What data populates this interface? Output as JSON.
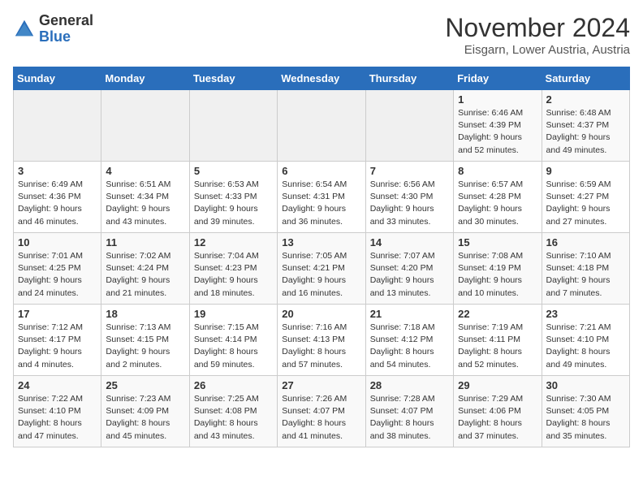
{
  "header": {
    "logo_general": "General",
    "logo_blue": "Blue",
    "month_title": "November 2024",
    "location": "Eisgarn, Lower Austria, Austria"
  },
  "weekdays": [
    "Sunday",
    "Monday",
    "Tuesday",
    "Wednesday",
    "Thursday",
    "Friday",
    "Saturday"
  ],
  "weeks": [
    [
      {
        "day": "",
        "info": ""
      },
      {
        "day": "",
        "info": ""
      },
      {
        "day": "",
        "info": ""
      },
      {
        "day": "",
        "info": ""
      },
      {
        "day": "",
        "info": ""
      },
      {
        "day": "1",
        "info": "Sunrise: 6:46 AM\nSunset: 4:39 PM\nDaylight: 9 hours\nand 52 minutes."
      },
      {
        "day": "2",
        "info": "Sunrise: 6:48 AM\nSunset: 4:37 PM\nDaylight: 9 hours\nand 49 minutes."
      }
    ],
    [
      {
        "day": "3",
        "info": "Sunrise: 6:49 AM\nSunset: 4:36 PM\nDaylight: 9 hours\nand 46 minutes."
      },
      {
        "day": "4",
        "info": "Sunrise: 6:51 AM\nSunset: 4:34 PM\nDaylight: 9 hours\nand 43 minutes."
      },
      {
        "day": "5",
        "info": "Sunrise: 6:53 AM\nSunset: 4:33 PM\nDaylight: 9 hours\nand 39 minutes."
      },
      {
        "day": "6",
        "info": "Sunrise: 6:54 AM\nSunset: 4:31 PM\nDaylight: 9 hours\nand 36 minutes."
      },
      {
        "day": "7",
        "info": "Sunrise: 6:56 AM\nSunset: 4:30 PM\nDaylight: 9 hours\nand 33 minutes."
      },
      {
        "day": "8",
        "info": "Sunrise: 6:57 AM\nSunset: 4:28 PM\nDaylight: 9 hours\nand 30 minutes."
      },
      {
        "day": "9",
        "info": "Sunrise: 6:59 AM\nSunset: 4:27 PM\nDaylight: 9 hours\nand 27 minutes."
      }
    ],
    [
      {
        "day": "10",
        "info": "Sunrise: 7:01 AM\nSunset: 4:25 PM\nDaylight: 9 hours\nand 24 minutes."
      },
      {
        "day": "11",
        "info": "Sunrise: 7:02 AM\nSunset: 4:24 PM\nDaylight: 9 hours\nand 21 minutes."
      },
      {
        "day": "12",
        "info": "Sunrise: 7:04 AM\nSunset: 4:23 PM\nDaylight: 9 hours\nand 18 minutes."
      },
      {
        "day": "13",
        "info": "Sunrise: 7:05 AM\nSunset: 4:21 PM\nDaylight: 9 hours\nand 16 minutes."
      },
      {
        "day": "14",
        "info": "Sunrise: 7:07 AM\nSunset: 4:20 PM\nDaylight: 9 hours\nand 13 minutes."
      },
      {
        "day": "15",
        "info": "Sunrise: 7:08 AM\nSunset: 4:19 PM\nDaylight: 9 hours\nand 10 minutes."
      },
      {
        "day": "16",
        "info": "Sunrise: 7:10 AM\nSunset: 4:18 PM\nDaylight: 9 hours\nand 7 minutes."
      }
    ],
    [
      {
        "day": "17",
        "info": "Sunrise: 7:12 AM\nSunset: 4:17 PM\nDaylight: 9 hours\nand 4 minutes."
      },
      {
        "day": "18",
        "info": "Sunrise: 7:13 AM\nSunset: 4:15 PM\nDaylight: 9 hours\nand 2 minutes."
      },
      {
        "day": "19",
        "info": "Sunrise: 7:15 AM\nSunset: 4:14 PM\nDaylight: 8 hours\nand 59 minutes."
      },
      {
        "day": "20",
        "info": "Sunrise: 7:16 AM\nSunset: 4:13 PM\nDaylight: 8 hours\nand 57 minutes."
      },
      {
        "day": "21",
        "info": "Sunrise: 7:18 AM\nSunset: 4:12 PM\nDaylight: 8 hours\nand 54 minutes."
      },
      {
        "day": "22",
        "info": "Sunrise: 7:19 AM\nSunset: 4:11 PM\nDaylight: 8 hours\nand 52 minutes."
      },
      {
        "day": "23",
        "info": "Sunrise: 7:21 AM\nSunset: 4:10 PM\nDaylight: 8 hours\nand 49 minutes."
      }
    ],
    [
      {
        "day": "24",
        "info": "Sunrise: 7:22 AM\nSunset: 4:10 PM\nDaylight: 8 hours\nand 47 minutes."
      },
      {
        "day": "25",
        "info": "Sunrise: 7:23 AM\nSunset: 4:09 PM\nDaylight: 8 hours\nand 45 minutes."
      },
      {
        "day": "26",
        "info": "Sunrise: 7:25 AM\nSunset: 4:08 PM\nDaylight: 8 hours\nand 43 minutes."
      },
      {
        "day": "27",
        "info": "Sunrise: 7:26 AM\nSunset: 4:07 PM\nDaylight: 8 hours\nand 41 minutes."
      },
      {
        "day": "28",
        "info": "Sunrise: 7:28 AM\nSunset: 4:07 PM\nDaylight: 8 hours\nand 38 minutes."
      },
      {
        "day": "29",
        "info": "Sunrise: 7:29 AM\nSunset: 4:06 PM\nDaylight: 8 hours\nand 37 minutes."
      },
      {
        "day": "30",
        "info": "Sunrise: 7:30 AM\nSunset: 4:05 PM\nDaylight: 8 hours\nand 35 minutes."
      }
    ]
  ]
}
